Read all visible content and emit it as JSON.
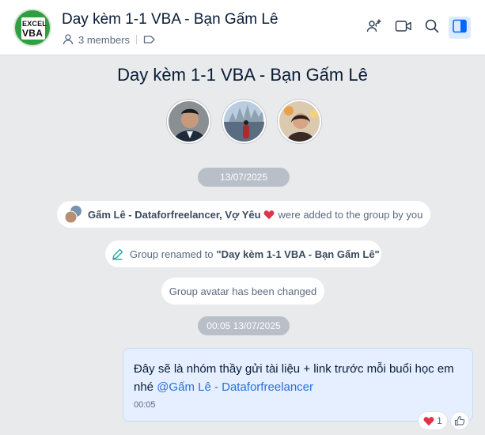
{
  "header": {
    "avatar_logo_line1": "EXCEL",
    "avatar_logo_line2": "VBA",
    "title": "Day kèm 1-1 VBA - Bạn Gấm Lê",
    "members": "3 members"
  },
  "conversation": {
    "group_name": "Day kèm 1-1 VBA - Bạn Gấm Lê",
    "first_date": "13/07/2025",
    "added_names": "Gấm Lê - Dataforfreelancer, Vợ Yêu",
    "added_suffix": "were added to the group by you",
    "renamed_prefix": "Group renamed to",
    "renamed_value": "\"Day kèm 1-1 VBA - Bạn Gấm Lê\"",
    "avatar_changed": "Group avatar has been changed",
    "second_date": "00:05 13/07/2025"
  },
  "message": {
    "text": "Đây sẽ là nhóm thầy gửi tài liệu + link trước mỗi buổi học em nhé",
    "mention": "@Gấm Lê - Dataforfreelancer",
    "time": "00:05",
    "reaction_count": "1"
  },
  "colors": {
    "accent": "#2a6fdb",
    "bubble": "#e5efff",
    "background": "#e9eaec",
    "heart": "#e0344a"
  },
  "icons": [
    "members-icon",
    "tag-icon",
    "add-member-icon",
    "video-call-icon",
    "search-icon",
    "sidebar-toggle-icon",
    "pencil-icon",
    "heart-icon",
    "like-icon"
  ]
}
